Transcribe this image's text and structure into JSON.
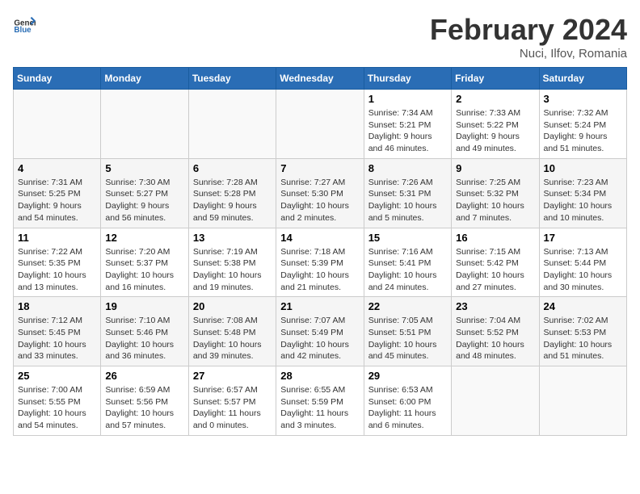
{
  "header": {
    "logo_general": "General",
    "logo_blue": "Blue",
    "month_year": "February 2024",
    "location": "Nuci, Ilfov, Romania"
  },
  "days_of_week": [
    "Sunday",
    "Monday",
    "Tuesday",
    "Wednesday",
    "Thursday",
    "Friday",
    "Saturday"
  ],
  "weeks": [
    [
      {
        "day": "",
        "info": ""
      },
      {
        "day": "",
        "info": ""
      },
      {
        "day": "",
        "info": ""
      },
      {
        "day": "",
        "info": ""
      },
      {
        "day": "1",
        "info": "Sunrise: 7:34 AM\nSunset: 5:21 PM\nDaylight: 9 hours\nand 46 minutes."
      },
      {
        "day": "2",
        "info": "Sunrise: 7:33 AM\nSunset: 5:22 PM\nDaylight: 9 hours\nand 49 minutes."
      },
      {
        "day": "3",
        "info": "Sunrise: 7:32 AM\nSunset: 5:24 PM\nDaylight: 9 hours\nand 51 minutes."
      }
    ],
    [
      {
        "day": "4",
        "info": "Sunrise: 7:31 AM\nSunset: 5:25 PM\nDaylight: 9 hours\nand 54 minutes."
      },
      {
        "day": "5",
        "info": "Sunrise: 7:30 AM\nSunset: 5:27 PM\nDaylight: 9 hours\nand 56 minutes."
      },
      {
        "day": "6",
        "info": "Sunrise: 7:28 AM\nSunset: 5:28 PM\nDaylight: 9 hours\nand 59 minutes."
      },
      {
        "day": "7",
        "info": "Sunrise: 7:27 AM\nSunset: 5:30 PM\nDaylight: 10 hours\nand 2 minutes."
      },
      {
        "day": "8",
        "info": "Sunrise: 7:26 AM\nSunset: 5:31 PM\nDaylight: 10 hours\nand 5 minutes."
      },
      {
        "day": "9",
        "info": "Sunrise: 7:25 AM\nSunset: 5:32 PM\nDaylight: 10 hours\nand 7 minutes."
      },
      {
        "day": "10",
        "info": "Sunrise: 7:23 AM\nSunset: 5:34 PM\nDaylight: 10 hours\nand 10 minutes."
      }
    ],
    [
      {
        "day": "11",
        "info": "Sunrise: 7:22 AM\nSunset: 5:35 PM\nDaylight: 10 hours\nand 13 minutes."
      },
      {
        "day": "12",
        "info": "Sunrise: 7:20 AM\nSunset: 5:37 PM\nDaylight: 10 hours\nand 16 minutes."
      },
      {
        "day": "13",
        "info": "Sunrise: 7:19 AM\nSunset: 5:38 PM\nDaylight: 10 hours\nand 19 minutes."
      },
      {
        "day": "14",
        "info": "Sunrise: 7:18 AM\nSunset: 5:39 PM\nDaylight: 10 hours\nand 21 minutes."
      },
      {
        "day": "15",
        "info": "Sunrise: 7:16 AM\nSunset: 5:41 PM\nDaylight: 10 hours\nand 24 minutes."
      },
      {
        "day": "16",
        "info": "Sunrise: 7:15 AM\nSunset: 5:42 PM\nDaylight: 10 hours\nand 27 minutes."
      },
      {
        "day": "17",
        "info": "Sunrise: 7:13 AM\nSunset: 5:44 PM\nDaylight: 10 hours\nand 30 minutes."
      }
    ],
    [
      {
        "day": "18",
        "info": "Sunrise: 7:12 AM\nSunset: 5:45 PM\nDaylight: 10 hours\nand 33 minutes."
      },
      {
        "day": "19",
        "info": "Sunrise: 7:10 AM\nSunset: 5:46 PM\nDaylight: 10 hours\nand 36 minutes."
      },
      {
        "day": "20",
        "info": "Sunrise: 7:08 AM\nSunset: 5:48 PM\nDaylight: 10 hours\nand 39 minutes."
      },
      {
        "day": "21",
        "info": "Sunrise: 7:07 AM\nSunset: 5:49 PM\nDaylight: 10 hours\nand 42 minutes."
      },
      {
        "day": "22",
        "info": "Sunrise: 7:05 AM\nSunset: 5:51 PM\nDaylight: 10 hours\nand 45 minutes."
      },
      {
        "day": "23",
        "info": "Sunrise: 7:04 AM\nSunset: 5:52 PM\nDaylight: 10 hours\nand 48 minutes."
      },
      {
        "day": "24",
        "info": "Sunrise: 7:02 AM\nSunset: 5:53 PM\nDaylight: 10 hours\nand 51 minutes."
      }
    ],
    [
      {
        "day": "25",
        "info": "Sunrise: 7:00 AM\nSunset: 5:55 PM\nDaylight: 10 hours\nand 54 minutes."
      },
      {
        "day": "26",
        "info": "Sunrise: 6:59 AM\nSunset: 5:56 PM\nDaylight: 10 hours\nand 57 minutes."
      },
      {
        "day": "27",
        "info": "Sunrise: 6:57 AM\nSunset: 5:57 PM\nDaylight: 11 hours\nand 0 minutes."
      },
      {
        "day": "28",
        "info": "Sunrise: 6:55 AM\nSunset: 5:59 PM\nDaylight: 11 hours\nand 3 minutes."
      },
      {
        "day": "29",
        "info": "Sunrise: 6:53 AM\nSunset: 6:00 PM\nDaylight: 11 hours\nand 6 minutes."
      },
      {
        "day": "",
        "info": ""
      },
      {
        "day": "",
        "info": ""
      }
    ]
  ]
}
